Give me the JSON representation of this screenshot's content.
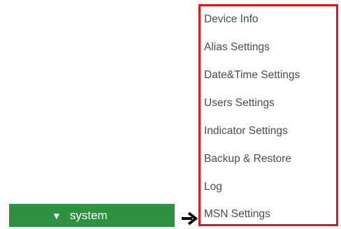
{
  "system_button": {
    "arrow_glyph": "▼",
    "label": "system",
    "background_color": "#2f9243",
    "text_color": "#ffffff"
  },
  "pointer_arrow": {
    "icon": "right-arrow-icon",
    "color": "#000000"
  },
  "menu": {
    "border_color": "#d71920",
    "text_color": "#4d4d4d",
    "items": [
      {
        "label": "Device Info"
      },
      {
        "label": "Alias Settings"
      },
      {
        "label": "Date&Time Settings"
      },
      {
        "label": "Users Settings"
      },
      {
        "label": "Indicator Settings"
      },
      {
        "label": "Backup & Restore"
      },
      {
        "label": "Log"
      },
      {
        "label": "MSN Settings"
      }
    ]
  }
}
